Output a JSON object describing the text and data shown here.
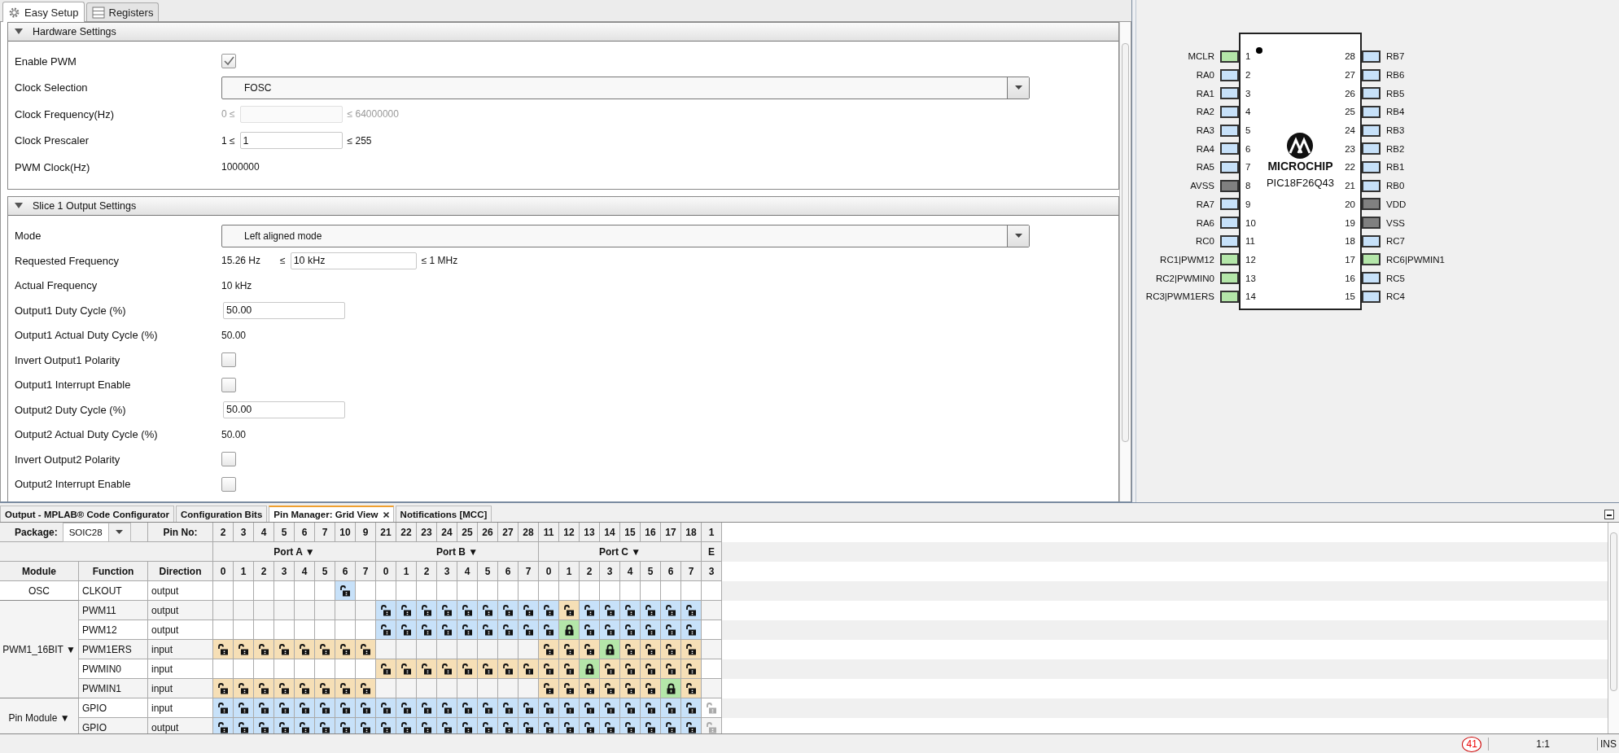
{
  "editor_tabs": [
    {
      "label": "Easy Setup",
      "selected": true
    },
    {
      "label": "Registers",
      "selected": false
    }
  ],
  "sections": [
    {
      "title": "Hardware Settings",
      "expanded": true,
      "rows": [
        {
          "kind": "checkbox",
          "label": "Enable PWM",
          "checked": true
        },
        {
          "kind": "dropdown",
          "label": "Clock Selection",
          "value": "FOSC"
        },
        {
          "kind": "range",
          "label": "Clock Frequency(Hz)",
          "disabled": true,
          "lower": [
            "0 ≤"
          ],
          "upper": "≤ 64000000"
        },
        {
          "kind": "range",
          "label": "Clock Prescaler",
          "disabled": false,
          "lower": [
            "1 ≤"
          ],
          "value": "1",
          "upper": "≤ 255"
        },
        {
          "kind": "text",
          "label": "PWM Clock(Hz)",
          "value": "1000000"
        }
      ]
    },
    {
      "title": "Slice 1 Output Settings",
      "expanded": true,
      "rows": [
        {
          "kind": "dropdown",
          "label": "Mode",
          "value": "Left aligned mode"
        },
        {
          "kind": "range",
          "label": "Requested Frequency",
          "disabled": false,
          "lower": [
            "15.26 Hz",
            "≤"
          ],
          "value": "10 kHz",
          "upper": "≤ 1 MHz"
        },
        {
          "kind": "text",
          "label": "Actual Frequency",
          "value": "10 kHz"
        },
        {
          "kind": "field",
          "label": "Output1 Duty Cycle (%)",
          "value": "50.00"
        },
        {
          "kind": "text",
          "label": "Output1 Actual Duty Cycle (%)",
          "value": "50.00"
        },
        {
          "kind": "checkbox",
          "label": "Invert Output1 Polarity",
          "checked": false
        },
        {
          "kind": "checkbox",
          "label": "Output1 Interrupt Enable",
          "checked": false
        },
        {
          "kind": "field",
          "label": "Output2 Duty Cycle (%)",
          "value": "50.00"
        },
        {
          "kind": "text",
          "label": "Output2 Actual Duty Cycle (%)",
          "value": "50.00"
        },
        {
          "kind": "checkbox",
          "label": "Invert Output2 Polarity",
          "checked": false
        },
        {
          "kind": "checkbox",
          "label": "Output2 Interrupt Enable",
          "checked": false
        }
      ]
    }
  ],
  "chip": {
    "brand": "MICROCHIP",
    "part": "PIC18F26Q43",
    "left_pins": [
      {
        "name": "MCLR",
        "number": "1",
        "color": "#b4e6a9"
      },
      {
        "name": "RA0",
        "number": "2",
        "color": "#c7e1f9"
      },
      {
        "name": "RA1",
        "number": "3",
        "color": "#c7e1f9"
      },
      {
        "name": "RA2",
        "number": "4",
        "color": "#c7e1f9"
      },
      {
        "name": "RA3",
        "number": "5",
        "color": "#c7e1f9"
      },
      {
        "name": "RA4",
        "number": "6",
        "color": "#c7e1f9"
      },
      {
        "name": "RA5",
        "number": "7",
        "color": "#c7e1f9"
      },
      {
        "name": "AVSS",
        "number": "8",
        "color": "#808080"
      },
      {
        "name": "RA7",
        "number": "9",
        "color": "#c7e1f9"
      },
      {
        "name": "RA6",
        "number": "10",
        "color": "#c7e1f9"
      },
      {
        "name": "RC0",
        "number": "11",
        "color": "#c7e1f9"
      },
      {
        "name": "RC1|PWM12",
        "number": "12",
        "color": "#b4e6a9"
      },
      {
        "name": "RC2|PWMIN0",
        "number": "13",
        "color": "#b4e6a9"
      },
      {
        "name": "RC3|PWM1ERS",
        "number": "14",
        "color": "#b4e6a9"
      }
    ],
    "right_pins": [
      {
        "name": "RB7",
        "number": "28",
        "color": "#c7e1f9"
      },
      {
        "name": "RB6",
        "number": "27",
        "color": "#c7e1f9"
      },
      {
        "name": "RB5",
        "number": "26",
        "color": "#c7e1f9"
      },
      {
        "name": "RB4",
        "number": "25",
        "color": "#c7e1f9"
      },
      {
        "name": "RB3",
        "number": "24",
        "color": "#c7e1f9"
      },
      {
        "name": "RB2",
        "number": "23",
        "color": "#c7e1f9"
      },
      {
        "name": "RB1",
        "number": "22",
        "color": "#c7e1f9"
      },
      {
        "name": "RB0",
        "number": "21",
        "color": "#c7e1f9"
      },
      {
        "name": "VDD",
        "number": "20",
        "color": "#808080"
      },
      {
        "name": "VSS",
        "number": "19",
        "color": "#808080"
      },
      {
        "name": "RC7",
        "number": "18",
        "color": "#c7e1f9"
      },
      {
        "name": "RC6|PWMIN1",
        "number": "17",
        "color": "#b4e6a9"
      },
      {
        "name": "RC5",
        "number": "16",
        "color": "#c7e1f9"
      },
      {
        "name": "RC4",
        "number": "15",
        "color": "#c7e1f9"
      }
    ]
  },
  "bottom_tabs": [
    {
      "label": "Output - MPLAB® Code Configurator",
      "selected": false,
      "closable": false
    },
    {
      "label": "Configuration Bits",
      "selected": false,
      "closable": false
    },
    {
      "label": "Pin Manager: Grid View",
      "selected": true,
      "closable": true
    },
    {
      "label": "Notifications [MCC]",
      "selected": false,
      "closable": false
    }
  ],
  "pin_grid": {
    "package_label": "Package:",
    "package": "SOIC28",
    "pin_no_label": "Pin No:",
    "pin_numbers": [
      "2",
      "3",
      "4",
      "5",
      "6",
      "7",
      "10",
      "9",
      "21",
      "22",
      "23",
      "24",
      "25",
      "26",
      "27",
      "28",
      "11",
      "12",
      "13",
      "14",
      "15",
      "16",
      "17",
      "18",
      "1"
    ],
    "ports": [
      {
        "label": "Port A ▼",
        "bits": [
          "0",
          "1",
          "2",
          "3",
          "4",
          "5",
          "6",
          "7"
        ]
      },
      {
        "label": "Port B ▼",
        "bits": [
          "0",
          "1",
          "2",
          "3",
          "4",
          "5",
          "6",
          "7"
        ]
      },
      {
        "label": "Port C ▼",
        "bits": [
          "0",
          "1",
          "2",
          "3",
          "4",
          "5",
          "6",
          "7"
        ]
      },
      {
        "label": "E",
        "bits": [
          "3"
        ]
      }
    ],
    "columns": [
      "Module",
      "Function",
      "Direction"
    ],
    "modules": [
      {
        "label": "OSC",
        "rows": [
          {
            "function": "CLKOUT",
            "direction": "output",
            "cells": [
              {
                "available": false
              },
              {
                "available": false
              },
              {
                "available": false
              },
              {
                "available": false
              },
              {
                "available": false
              },
              {
                "available": false
              },
              {
                "available": true,
                "locked": false,
                "color": "#c7e1f9"
              },
              {
                "available": false
              },
              {
                "available": false
              },
              {
                "available": false
              },
              {
                "available": false
              },
              {
                "available": false
              },
              {
                "available": false
              },
              {
                "available": false
              },
              {
                "available": false
              },
              {
                "available": false
              },
              {
                "available": false
              },
              {
                "available": false
              },
              {
                "available": false
              },
              {
                "available": false
              },
              {
                "available": false
              },
              {
                "available": false
              },
              {
                "available": false
              },
              {
                "available": false
              },
              {
                "available": false
              }
            ]
          }
        ]
      },
      {
        "label": "PWM1_16BIT ▼",
        "rows": [
          {
            "function": "PWM11",
            "direction": "output",
            "cells": [
              {
                "available": false
              },
              {
                "available": false
              },
              {
                "available": false
              },
              {
                "available": false
              },
              {
                "available": false
              },
              {
                "available": false
              },
              {
                "available": false
              },
              {
                "available": false
              },
              {
                "available": true,
                "locked": false,
                "color": "#c7e1f9"
              },
              {
                "available": true,
                "locked": false,
                "color": "#c7e1f9"
              },
              {
                "available": true,
                "locked": false,
                "color": "#c7e1f9"
              },
              {
                "available": true,
                "locked": false,
                "color": "#c7e1f9"
              },
              {
                "available": true,
                "locked": false,
                "color": "#c7e1f9"
              },
              {
                "available": true,
                "locked": false,
                "color": "#c7e1f9"
              },
              {
                "available": true,
                "locked": false,
                "color": "#c7e1f9"
              },
              {
                "available": true,
                "locked": false,
                "color": "#c7e1f9"
              },
              {
                "available": true,
                "locked": false,
                "color": "#c7e1f9"
              },
              {
                "available": true,
                "locked": false,
                "color": "#f6dfb6"
              },
              {
                "available": true,
                "locked": false,
                "color": "#c7e1f9"
              },
              {
                "available": true,
                "locked": false,
                "color": "#c7e1f9"
              },
              {
                "available": true,
                "locked": false,
                "color": "#c7e1f9"
              },
              {
                "available": true,
                "locked": false,
                "color": "#c7e1f9"
              },
              {
                "available": true,
                "locked": false,
                "color": "#c7e1f9"
              },
              {
                "available": true,
                "locked": false,
                "color": "#c7e1f9"
              },
              {
                "available": false
              }
            ]
          },
          {
            "function": "PWM12",
            "direction": "output",
            "cells": [
              {
                "available": false
              },
              {
                "available": false
              },
              {
                "available": false
              },
              {
                "available": false
              },
              {
                "available": false
              },
              {
                "available": false
              },
              {
                "available": false
              },
              {
                "available": false
              },
              {
                "available": true,
                "locked": false,
                "color": "#c7e1f9"
              },
              {
                "available": true,
                "locked": false,
                "color": "#c7e1f9"
              },
              {
                "available": true,
                "locked": false,
                "color": "#c7e1f9"
              },
              {
                "available": true,
                "locked": false,
                "color": "#c7e1f9"
              },
              {
                "available": true,
                "locked": false,
                "color": "#c7e1f9"
              },
              {
                "available": true,
                "locked": false,
                "color": "#c7e1f9"
              },
              {
                "available": true,
                "locked": false,
                "color": "#c7e1f9"
              },
              {
                "available": true,
                "locked": false,
                "color": "#c7e1f9"
              },
              {
                "available": true,
                "locked": false,
                "color": "#c7e1f9"
              },
              {
                "available": true,
                "locked": true,
                "color": "#b4e6a9"
              },
              {
                "available": true,
                "locked": false,
                "color": "#c7e1f9"
              },
              {
                "available": true,
                "locked": false,
                "color": "#c7e1f9"
              },
              {
                "available": true,
                "locked": false,
                "color": "#c7e1f9"
              },
              {
                "available": true,
                "locked": false,
                "color": "#c7e1f9"
              },
              {
                "available": true,
                "locked": false,
                "color": "#c7e1f9"
              },
              {
                "available": true,
                "locked": false,
                "color": "#c7e1f9"
              },
              {
                "available": false
              }
            ]
          },
          {
            "function": "PWM1ERS",
            "direction": "input",
            "cells": [
              {
                "available": true,
                "locked": false,
                "color": "#f6dfb6"
              },
              {
                "available": true,
                "locked": false,
                "color": "#f6dfb6"
              },
              {
                "available": true,
                "locked": false,
                "color": "#f6dfb6"
              },
              {
                "available": true,
                "locked": false,
                "color": "#f6dfb6"
              },
              {
                "available": true,
                "locked": false,
                "color": "#f6dfb6"
              },
              {
                "available": true,
                "locked": false,
                "color": "#f6dfb6"
              },
              {
                "available": true,
                "locked": false,
                "color": "#f6dfb6"
              },
              {
                "available": true,
                "locked": false,
                "color": "#f6dfb6"
              },
              {
                "available": false
              },
              {
                "available": false
              },
              {
                "available": false
              },
              {
                "available": false
              },
              {
                "available": false
              },
              {
                "available": false
              },
              {
                "available": false
              },
              {
                "available": false
              },
              {
                "available": true,
                "locked": false,
                "color": "#f6dfb6"
              },
              {
                "available": true,
                "locked": false,
                "color": "#f6dfb6"
              },
              {
                "available": true,
                "locked": false,
                "color": "#f6dfb6"
              },
              {
                "available": true,
                "locked": true,
                "color": "#b4e6a9"
              },
              {
                "available": true,
                "locked": false,
                "color": "#f6dfb6"
              },
              {
                "available": true,
                "locked": false,
                "color": "#f6dfb6"
              },
              {
                "available": true,
                "locked": false,
                "color": "#f6dfb6"
              },
              {
                "available": true,
                "locked": false,
                "color": "#f6dfb6"
              },
              {
                "available": false
              }
            ]
          },
          {
            "function": "PWMIN0",
            "direction": "input",
            "cells": [
              {
                "available": false
              },
              {
                "available": false
              },
              {
                "available": false
              },
              {
                "available": false
              },
              {
                "available": false
              },
              {
                "available": false
              },
              {
                "available": false
              },
              {
                "available": false
              },
              {
                "available": true,
                "locked": false,
                "color": "#f6dfb6"
              },
              {
                "available": true,
                "locked": false,
                "color": "#f6dfb6"
              },
              {
                "available": true,
                "locked": false,
                "color": "#f6dfb6"
              },
              {
                "available": true,
                "locked": false,
                "color": "#f6dfb6"
              },
              {
                "available": true,
                "locked": false,
                "color": "#f6dfb6"
              },
              {
                "available": true,
                "locked": false,
                "color": "#f6dfb6"
              },
              {
                "available": true,
                "locked": false,
                "color": "#f6dfb6"
              },
              {
                "available": true,
                "locked": false,
                "color": "#f6dfb6"
              },
              {
                "available": true,
                "locked": false,
                "color": "#f6dfb6"
              },
              {
                "available": true,
                "locked": false,
                "color": "#f6dfb6"
              },
              {
                "available": true,
                "locked": true,
                "color": "#b4e6a9"
              },
              {
                "available": true,
                "locked": false,
                "color": "#f6dfb6"
              },
              {
                "available": true,
                "locked": false,
                "color": "#f6dfb6"
              },
              {
                "available": true,
                "locked": false,
                "color": "#f6dfb6"
              },
              {
                "available": true,
                "locked": false,
                "color": "#f6dfb6"
              },
              {
                "available": true,
                "locked": false,
                "color": "#f6dfb6"
              },
              {
                "available": false
              }
            ]
          },
          {
            "function": "PWMIN1",
            "direction": "input",
            "cells": [
              {
                "available": true,
                "locked": false,
                "color": "#f6dfb6"
              },
              {
                "available": true,
                "locked": false,
                "color": "#f6dfb6"
              },
              {
                "available": true,
                "locked": false,
                "color": "#f6dfb6"
              },
              {
                "available": true,
                "locked": false,
                "color": "#f6dfb6"
              },
              {
                "available": true,
                "locked": false,
                "color": "#f6dfb6"
              },
              {
                "available": true,
                "locked": false,
                "color": "#f6dfb6"
              },
              {
                "available": true,
                "locked": false,
                "color": "#f6dfb6"
              },
              {
                "available": true,
                "locked": false,
                "color": "#f6dfb6"
              },
              {
                "available": false
              },
              {
                "available": false
              },
              {
                "available": false
              },
              {
                "available": false
              },
              {
                "available": false
              },
              {
                "available": false
              },
              {
                "available": false
              },
              {
                "available": false
              },
              {
                "available": true,
                "locked": false,
                "color": "#f6dfb6"
              },
              {
                "available": true,
                "locked": false,
                "color": "#f6dfb6"
              },
              {
                "available": true,
                "locked": false,
                "color": "#f6dfb6"
              },
              {
                "available": true,
                "locked": false,
                "color": "#f6dfb6"
              },
              {
                "available": true,
                "locked": false,
                "color": "#f6dfb6"
              },
              {
                "available": true,
                "locked": false,
                "color": "#f6dfb6"
              },
              {
                "available": true,
                "locked": true,
                "color": "#b4e6a9"
              },
              {
                "available": true,
                "locked": false,
                "color": "#f6dfb6"
              },
              {
                "available": false
              }
            ]
          }
        ]
      },
      {
        "label": "Pin Module ▼",
        "rows": [
          {
            "function": "GPIO",
            "direction": "input",
            "cells": [
              {
                "available": true,
                "locked": false,
                "color": "#c7e1f9"
              },
              {
                "available": true,
                "locked": false,
                "color": "#c7e1f9"
              },
              {
                "available": true,
                "locked": false,
                "color": "#c7e1f9"
              },
              {
                "available": true,
                "locked": false,
                "color": "#c7e1f9"
              },
              {
                "available": true,
                "locked": false,
                "color": "#c7e1f9"
              },
              {
                "available": true,
                "locked": false,
                "color": "#c7e1f9"
              },
              {
                "available": true,
                "locked": false,
                "color": "#c7e1f9"
              },
              {
                "available": true,
                "locked": false,
                "color": "#c7e1f9"
              },
              {
                "available": true,
                "locked": false,
                "color": "#c7e1f9"
              },
              {
                "available": true,
                "locked": false,
                "color": "#c7e1f9"
              },
              {
                "available": true,
                "locked": false,
                "color": "#c7e1f9"
              },
              {
                "available": true,
                "locked": false,
                "color": "#c7e1f9"
              },
              {
                "available": true,
                "locked": false,
                "color": "#c7e1f9"
              },
              {
                "available": true,
                "locked": false,
                "color": "#c7e1f9"
              },
              {
                "available": true,
                "locked": false,
                "color": "#c7e1f9"
              },
              {
                "available": true,
                "locked": false,
                "color": "#c7e1f9"
              },
              {
                "available": true,
                "locked": false,
                "color": "#c7e1f9"
              },
              {
                "available": true,
                "locked": false,
                "color": "#c7e1f9"
              },
              {
                "available": true,
                "locked": false,
                "color": "#c7e1f9"
              },
              {
                "available": true,
                "locked": false,
                "color": "#c7e1f9"
              },
              {
                "available": true,
                "locked": false,
                "color": "#c7e1f9"
              },
              {
                "available": true,
                "locked": false,
                "color": "#c7e1f9"
              },
              {
                "available": true,
                "locked": false,
                "color": "#c7e1f9"
              },
              {
                "available": true,
                "locked": false,
                "color": "#c7e1f9"
              },
              {
                "available": true,
                "locked": false,
                "disabled": true
              }
            ]
          },
          {
            "function": "GPIO",
            "direction": "output",
            "cells": [
              {
                "available": true,
                "locked": false,
                "color": "#c7e1f9"
              },
              {
                "available": true,
                "locked": false,
                "color": "#c7e1f9"
              },
              {
                "available": true,
                "locked": false,
                "color": "#c7e1f9"
              },
              {
                "available": true,
                "locked": false,
                "color": "#c7e1f9"
              },
              {
                "available": true,
                "locked": false,
                "color": "#c7e1f9"
              },
              {
                "available": true,
                "locked": false,
                "color": "#c7e1f9"
              },
              {
                "available": true,
                "locked": false,
                "color": "#c7e1f9"
              },
              {
                "available": true,
                "locked": false,
                "color": "#c7e1f9"
              },
              {
                "available": true,
                "locked": false,
                "color": "#c7e1f9"
              },
              {
                "available": true,
                "locked": false,
                "color": "#c7e1f9"
              },
              {
                "available": true,
                "locked": false,
                "color": "#c7e1f9"
              },
              {
                "available": true,
                "locked": false,
                "color": "#c7e1f9"
              },
              {
                "available": true,
                "locked": false,
                "color": "#c7e1f9"
              },
              {
                "available": true,
                "locked": false,
                "color": "#c7e1f9"
              },
              {
                "available": true,
                "locked": false,
                "color": "#c7e1f9"
              },
              {
                "available": true,
                "locked": false,
                "color": "#c7e1f9"
              },
              {
                "available": true,
                "locked": false,
                "color": "#c7e1f9"
              },
              {
                "available": true,
                "locked": false,
                "color": "#c7e1f9"
              },
              {
                "available": true,
                "locked": false,
                "color": "#c7e1f9"
              },
              {
                "available": true,
                "locked": false,
                "color": "#c7e1f9"
              },
              {
                "available": true,
                "locked": false,
                "color": "#c7e1f9"
              },
              {
                "available": true,
                "locked": false,
                "color": "#c7e1f9"
              },
              {
                "available": true,
                "locked": false,
                "color": "#c7e1f9"
              },
              {
                "available": true,
                "locked": false,
                "color": "#c7e1f9"
              },
              {
                "available": true,
                "locked": false,
                "disabled": true
              }
            ]
          }
        ]
      }
    ]
  },
  "status_bar": {
    "notifications": "41",
    "position": "1:1",
    "mode": "INS"
  }
}
